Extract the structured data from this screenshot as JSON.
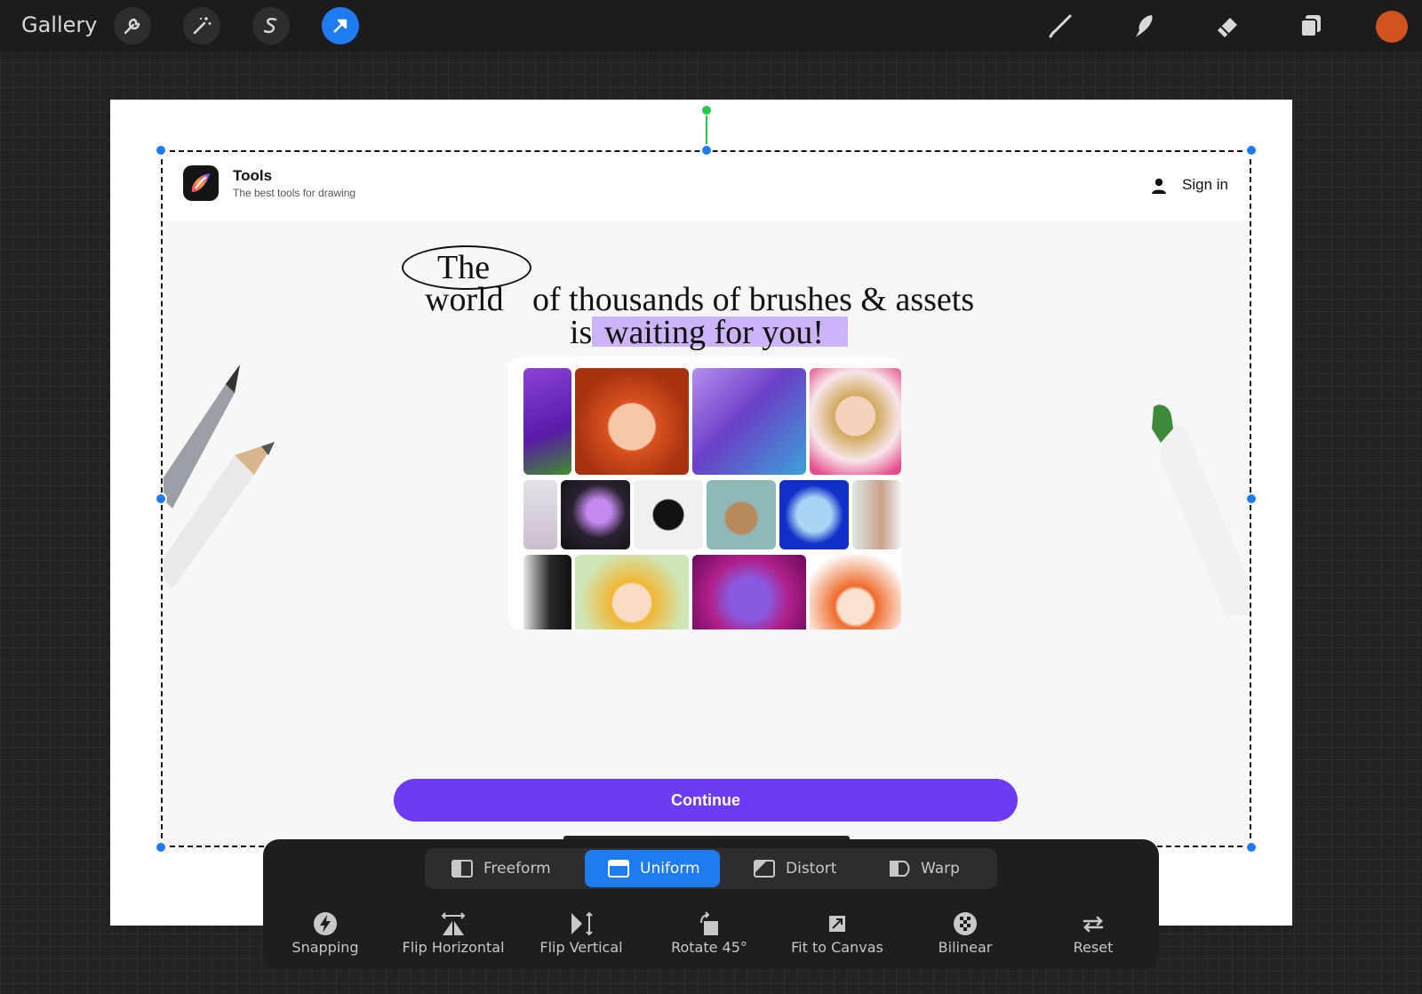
{
  "topbar": {
    "gallery_label": "Gallery",
    "left_tools": [
      "wrench-icon",
      "magic-wand-icon",
      "selection-s-icon",
      "transform-arrow-icon"
    ],
    "right_tools": [
      "brush-icon",
      "smudge-icon",
      "eraser-icon",
      "layers-icon"
    ],
    "active_tool": "transform-arrow-icon",
    "current_color": "#d0531d"
  },
  "app": {
    "name": "Tools",
    "tagline": "The best tools for drawing",
    "sign_in": "Sign in",
    "headline": {
      "word_the": "The",
      "word_world": "world",
      "line2_rest": "of thousands of brushes & assets",
      "word_is": "is",
      "line3_rest": "waiting for you!"
    },
    "continue_label": "Continue",
    "accent": "#6c3cf5"
  },
  "transform": {
    "modes": [
      "Freeform",
      "Uniform",
      "Distort",
      "Warp"
    ],
    "active_mode": "Uniform",
    "actions": [
      "Snapping",
      "Flip Horizontal",
      "Flip Vertical",
      "Rotate 45°",
      "Fit to Canvas",
      "Bilinear",
      "Reset"
    ]
  }
}
